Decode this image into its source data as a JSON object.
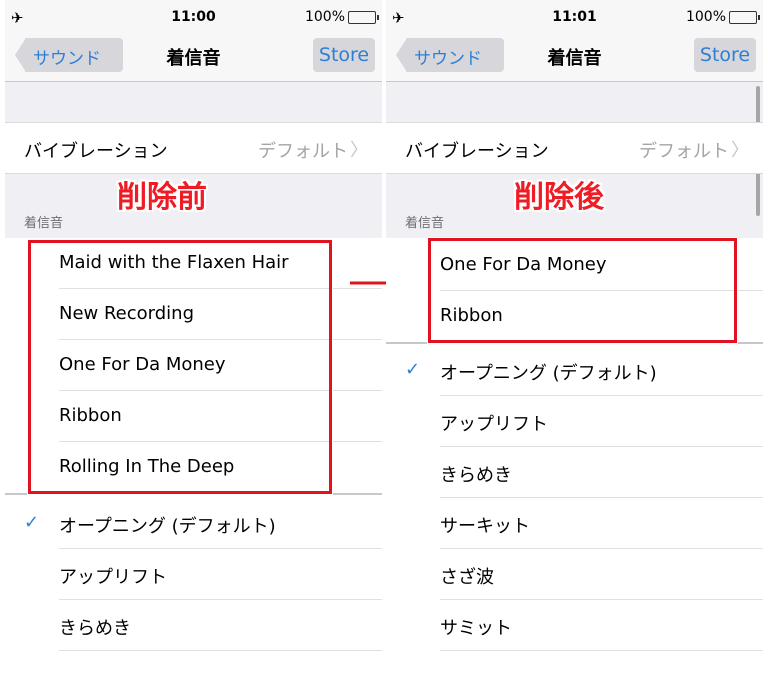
{
  "left": {
    "status": {
      "time": "11:00",
      "battery": "100%"
    },
    "nav": {
      "back": "サウンド",
      "title": "着信音",
      "store": "Store"
    },
    "vibration": {
      "label": "バイブレーション",
      "value": "デフォルト"
    },
    "annotation": "削除前",
    "section_header": "着信音",
    "custom_tones": [
      "Maid with the Flaxen Hair",
      "New Recording",
      "One For Da Money",
      "Ribbon",
      "Rolling In The Deep"
    ],
    "builtin_tones": [
      "オープニング (デフォルト)",
      "アップリフト",
      "きらめき"
    ],
    "selected": "オープニング (デフォルト)"
  },
  "right": {
    "status": {
      "time": "11:01",
      "battery": "100%"
    },
    "nav": {
      "back": "サウンド",
      "title": "着信音",
      "store": "Store"
    },
    "vibration": {
      "label": "バイブレーション",
      "value": "デフォルト"
    },
    "annotation": "削除後",
    "section_header": "着信音",
    "custom_tones": [
      "One For Da Money",
      "Ribbon"
    ],
    "builtin_tones": [
      "オープニング (デフォルト)",
      "アップリフト",
      "きらめき",
      "サーキット",
      "さざ波",
      "サミット"
    ],
    "selected": "オープニング (デフォルト)"
  },
  "icons": {
    "airplane": "airplane-icon",
    "battery": "battery-icon",
    "chevron": "chevron-right-icon",
    "check": "checkmark-icon",
    "arrow": "red-arrow-icon"
  },
  "colors": {
    "accent": "#2d7fd6",
    "highlight": "#e0141e",
    "battery": "#4cd964"
  }
}
